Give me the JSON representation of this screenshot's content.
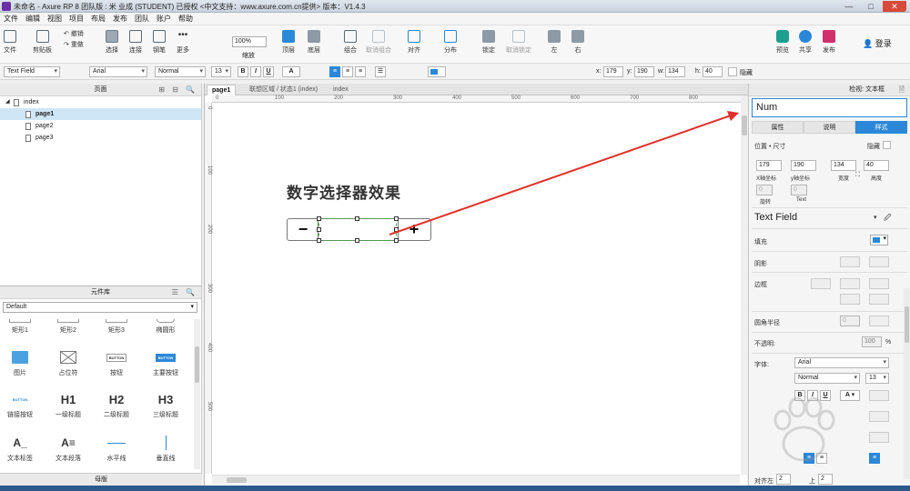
{
  "window": {
    "title": "未命名 - Axure RP 8 团队版 : 米 业成 (STUDENT) 已授权    <中文支持：www.axure.com.cn提供> 版本：V1.4.3",
    "minimize": "—",
    "maximize": "□",
    "close": "✕"
  },
  "menu": [
    "文件",
    "编辑",
    "视图",
    "项目",
    "布局",
    "发布",
    "团队",
    "账户",
    "帮助"
  ],
  "toolbar": {
    "file": "文件",
    "clipboard": "剪贴板",
    "cut": "✂",
    "copy": "⎘",
    "undo": "撤销",
    "redo": "重做",
    "select": "选择",
    "connect": "连接",
    "pen": "钢笔",
    "more": "更多",
    "zoom_value": "100%",
    "zoom_label": "缩放",
    "top": "顶层",
    "bottom": "底层",
    "group": "组合",
    "ungroup": "取消组合",
    "align": "对齐",
    "distribute": "分布",
    "lock": "锁定",
    "unlock": "取消锁定",
    "left": "左",
    "right": "右",
    "preview": "预览",
    "share": "共享",
    "publish": "发布",
    "login": "登录"
  },
  "format": {
    "widget_type": "Text Field",
    "font": "Arial",
    "style": "Normal",
    "size": "13",
    "bold": "B",
    "italic": "I",
    "underline": "U",
    "text_color": "A",
    "x_label": "x:",
    "x": "179",
    "y_label": "y:",
    "y": "190",
    "w_label": "w:",
    "w": "134",
    "h_label": "h:",
    "h": "40",
    "hidden": "隐藏"
  },
  "pages_panel": {
    "title": "页面",
    "items": [
      {
        "label": "index"
      },
      {
        "label": "page1"
      },
      {
        "label": "page2"
      },
      {
        "label": "page3"
      }
    ]
  },
  "library_panel": {
    "title": "元件库",
    "selected": "Default",
    "widgets": [
      {
        "label": "矩形1",
        "icon": "rect-icon"
      },
      {
        "label": "矩形2",
        "icon": "rect-icon"
      },
      {
        "label": "矩形3",
        "icon": "rect-icon"
      },
      {
        "label": "椭圆形",
        "icon": "ellipse-icon"
      },
      {
        "label": "图片",
        "icon": "image-icon"
      },
      {
        "label": "占位符",
        "icon": "placeholder-icon"
      },
      {
        "label": "按钮",
        "icon": "button-icon"
      },
      {
        "label": "主要按钮",
        "icon": "primary-button-icon"
      },
      {
        "label": "链接按钮",
        "icon": "link-button-icon"
      },
      {
        "label": "一级标题",
        "icon": "h1-icon"
      },
      {
        "label": "二级标题",
        "icon": "h2-icon"
      },
      {
        "label": "三级标题",
        "icon": "h3-icon"
      },
      {
        "label": "文本标签",
        "icon": "text-label-icon"
      },
      {
        "label": "文本段落",
        "icon": "paragraph-icon"
      },
      {
        "label": "水平线",
        "icon": "hline-icon"
      },
      {
        "label": "垂直线",
        "icon": "vline-icon"
      }
    ],
    "button_text": "BUTTON",
    "h1": "H1",
    "h2": "H2",
    "h3": "H3",
    "text_glyph": "A_",
    "paragraph_glyph": "A≡"
  },
  "master_panel": {
    "title": "母版"
  },
  "canvas": {
    "tabs": [
      {
        "label": "page1"
      },
      {
        "label": "联想区域 / 状态1 (index)"
      },
      {
        "label": "index"
      }
    ],
    "ruler_h": [
      "0",
      "100",
      "200",
      "300",
      "400",
      "500",
      "600",
      "700",
      "800"
    ],
    "ruler_v": [
      "0",
      "100",
      "200",
      "300",
      "400",
      "500"
    ],
    "heading": "数字选择器效果",
    "minus": "−",
    "plus": "+"
  },
  "inspector": {
    "title": "检视: 文本框",
    "name_value": "Num",
    "tabs": [
      "属性",
      "说明",
      "样式"
    ],
    "position_size": "位置 • 尺寸",
    "hidden": "隐藏",
    "x": "179",
    "y": "190",
    "w": "134",
    "h": "40",
    "x_label": "X轴坐标",
    "y_label": "y轴坐标",
    "w_label": "宽度",
    "h_label": "高度",
    "rotate_val": "0",
    "text_val": "0",
    "rotate_label": "旋转",
    "text_label": "Text",
    "style_name": "Text Field",
    "fill": "填充",
    "shadow": "阴影",
    "border": "边框",
    "radius": "圆角半径",
    "radius_val": "0",
    "opacity": "不透明:",
    "opacity_val": "100",
    "percent": "%",
    "font": "字体:",
    "font_val": "Arial",
    "font_style": "Normal",
    "font_size": "13",
    "align_label": "对齐",
    "left": "左",
    "left_val": "2",
    "top": "上",
    "top_val": "2"
  },
  "colors": {
    "accent": "#2b88d8",
    "arrow": "#e0302b",
    "selection": "#3cb043"
  }
}
